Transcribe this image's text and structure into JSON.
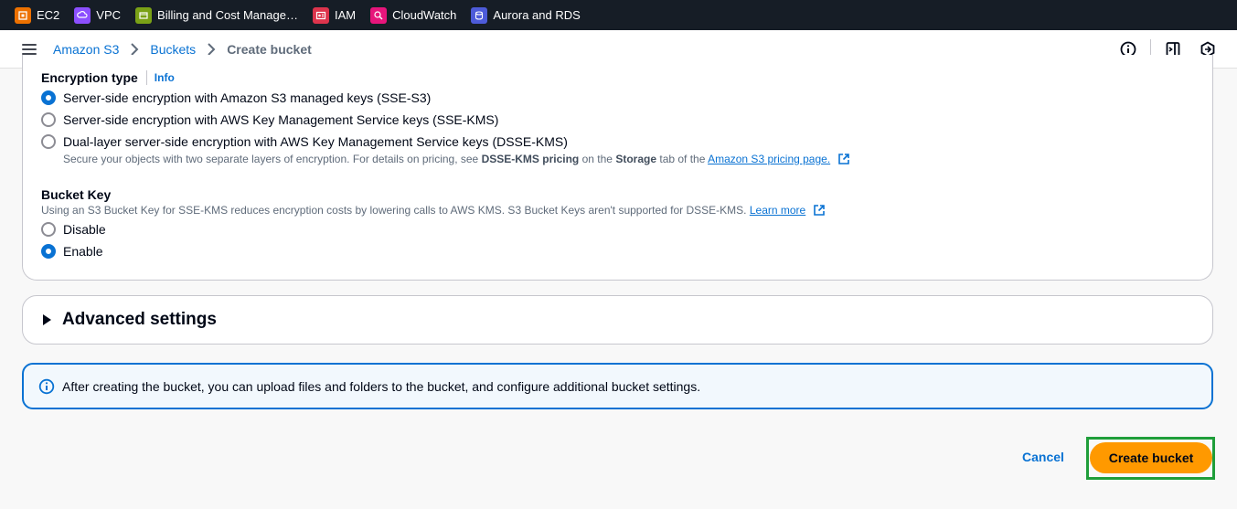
{
  "favorites": [
    {
      "label": "EC2",
      "icon": "ec2-icon",
      "color": "#ed7100"
    },
    {
      "label": "VPC",
      "icon": "vpc-icon",
      "color": "#8c4fff"
    },
    {
      "label": "Billing and Cost Manage…",
      "icon": "billing-icon",
      "color": "#7aa116"
    },
    {
      "label": "IAM",
      "icon": "iam-icon",
      "color": "#dd344c"
    },
    {
      "label": "CloudWatch",
      "icon": "cloudwatch-icon",
      "color": "#e7157b"
    },
    {
      "label": "Aurora and RDS",
      "icon": "rds-icon",
      "color": "#4d5bd9"
    }
  ],
  "breadcrumb": {
    "items": [
      "Amazon S3",
      "Buckets"
    ],
    "current": "Create bucket"
  },
  "encryption": {
    "title": "Encryption type",
    "info": "Info",
    "options": [
      {
        "label": "Server-side encryption with Amazon S3 managed keys (SSE-S3)",
        "checked": true
      },
      {
        "label": "Server-side encryption with AWS Key Management Service keys (SSE-KMS)",
        "checked": false
      },
      {
        "label": "Dual-layer server-side encryption with AWS Key Management Service keys (DSSE-KMS)",
        "checked": false
      }
    ],
    "dsse_desc_pre": "Secure your objects with two separate layers of encryption. For details on pricing, see",
    "dsse_desc_bold1": "DSSE-KMS pricing",
    "dsse_desc_mid": "on the",
    "dsse_desc_bold2": "Storage",
    "dsse_desc_post": "tab of the",
    "dsse_desc_link": "Amazon S3 pricing page."
  },
  "bucket_key": {
    "title": "Bucket Key",
    "desc": "Using an S3 Bucket Key for SSE-KMS reduces encryption costs by lowering calls to AWS KMS. S3 Bucket Keys aren't supported for DSSE-KMS.",
    "learn_more": "Learn more",
    "options": [
      {
        "label": "Disable",
        "checked": false
      },
      {
        "label": "Enable",
        "checked": true
      }
    ]
  },
  "advanced": {
    "title": "Advanced settings"
  },
  "alert": {
    "text": "After creating the bucket, you can upload files and folders to the bucket, and configure additional bucket settings."
  },
  "footer": {
    "cancel": "Cancel",
    "create": "Create bucket"
  }
}
